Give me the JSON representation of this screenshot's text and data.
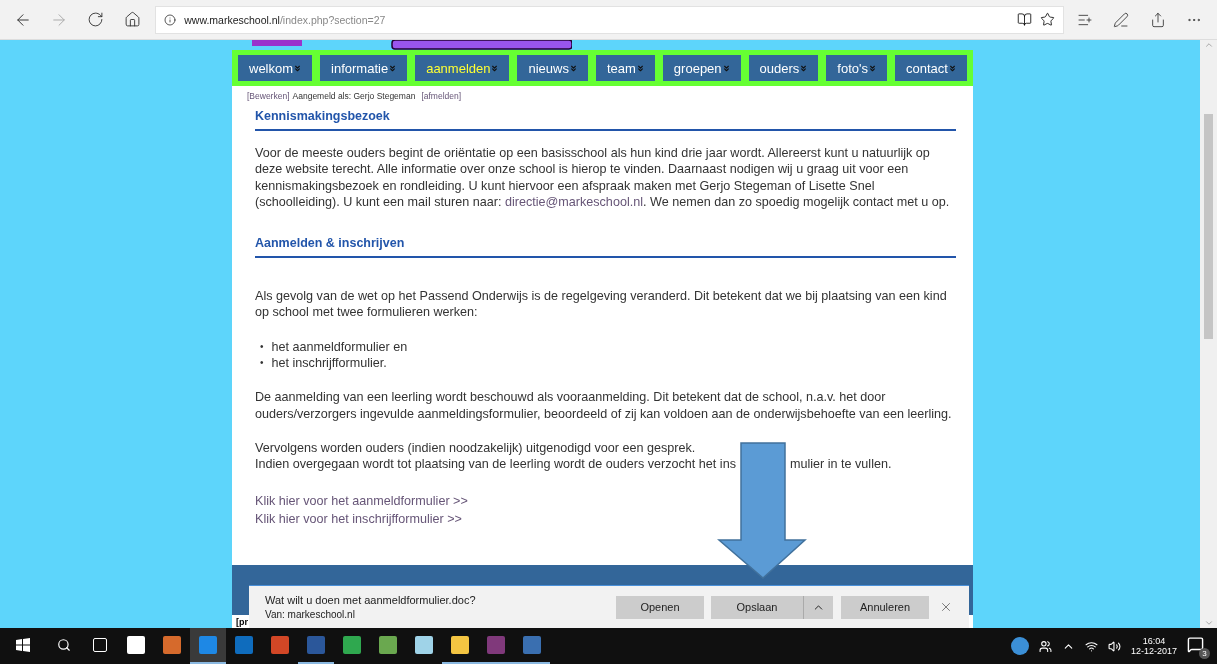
{
  "browser": {
    "url": {
      "host": "www.markeschool.nl",
      "path": "/index.php?section=27"
    }
  },
  "nav": [
    {
      "label": "welkom",
      "selected": false
    },
    {
      "label": "informatie",
      "selected": false
    },
    {
      "label": "aanmelden",
      "selected": true
    },
    {
      "label": "nieuws",
      "selected": false
    },
    {
      "label": "team",
      "selected": false
    },
    {
      "label": "groepen",
      "selected": false
    },
    {
      "label": "ouders",
      "selected": false
    },
    {
      "label": "foto's",
      "selected": false
    },
    {
      "label": "contact",
      "selected": false
    }
  ],
  "login": {
    "edit": "[Bewerken]",
    "text": "Aangemeld als: Gerjo Stegeman",
    "logout": "[afmelden]"
  },
  "sections": [
    {
      "heading": "Kennismakingsbezoek",
      "blocks": [
        {
          "kind": "paragraph",
          "parts": [
            {
              "text": "Voor de meeste ouders begint de oriëntatie op een basisschool als hun kind drie jaar wordt. Allereerst kunt u natuurlijk op deze website terecht. Alle informatie over onze school is hierop te vinden. Daarnaast nodigen wij u graag uit voor een kennismakingsbezoek en rondleiding. U kunt hiervoor een afspraak maken met Gerjo Stegeman of Lisette Snel (schoolleiding). U kunt een mail sturen naar: ",
              "link": false
            },
            {
              "text": "directie@markeschool.nl",
              "link": true
            },
            {
              "text": ". We nemen dan zo spoedig mogelijk contact met u op.",
              "link": false
            }
          ]
        }
      ]
    },
    {
      "heading": "Aanmelden & inschrijven",
      "blocks": [
        {
          "kind": "paragraph",
          "parts": [
            {
              "text": "Als gevolg van de wet op het Passend Onderwijs is de regelgeving veranderd. Dit betekent dat we bij plaatsing van een kind op school met twee formulieren werken:",
              "link": false
            }
          ]
        },
        {
          "kind": "list",
          "items": [
            {
              "bullet": "•",
              "text": "het aanmeldformulier en"
            },
            {
              "bullet": "•",
              "text": "het inschrijfformulier."
            }
          ]
        },
        {
          "kind": "paragraph",
          "parts": [
            {
              "text": "De aanmelding van een leerling wordt beschouwd als vooraanmelding. Dit betekent dat de school, n.a.v. het door ouders/verzorgers ingevulde aanmeldingsformulier, beoordeeld of zij kan voldoen aan de onderwijsbehoefte van een leerling.",
              "link": false
            }
          ]
        },
        {
          "kind": "lines",
          "lines": [
            [
              "Vervolgens worden ouders (indien noodzakelijk) uitgenodigd voor een gesprek."
            ],
            [
              "Indien overgegaan wordt tot plaatsing van de leerling wordt de ouders verzocht het ins",
              "mulier in te vullen."
            ]
          ]
        },
        {
          "kind": "links",
          "items": [
            "Klik hier voor het aanmeldformulier >>",
            "Klik hier voor het inschrijfformulier >>"
          ]
        }
      ]
    }
  ],
  "footer": {
    "text": "[pr"
  },
  "download": {
    "question": "Wat wilt u doen met aanmeldformulier.doc?",
    "source": "Van: markeschool.nl",
    "buttons": [
      "Openen",
      "Opslaan",
      "Annuleren"
    ]
  },
  "taskbar": {
    "apps": [
      {
        "open": true,
        "selected": true
      },
      {
        "open": false,
        "selected": false
      },
      {
        "open": false,
        "selected": false
      },
      {
        "open": true,
        "selected": false
      },
      {
        "open": false,
        "selected": false
      },
      {
        "open": false,
        "selected": false
      },
      {
        "open": false,
        "selected": false
      },
      {
        "open": true,
        "selected": false
      },
      {
        "open": true,
        "selected": false
      },
      {
        "open": true,
        "selected": false
      }
    ],
    "time": "16:04",
    "date": "12-12-2017",
    "notifications": "3"
  }
}
